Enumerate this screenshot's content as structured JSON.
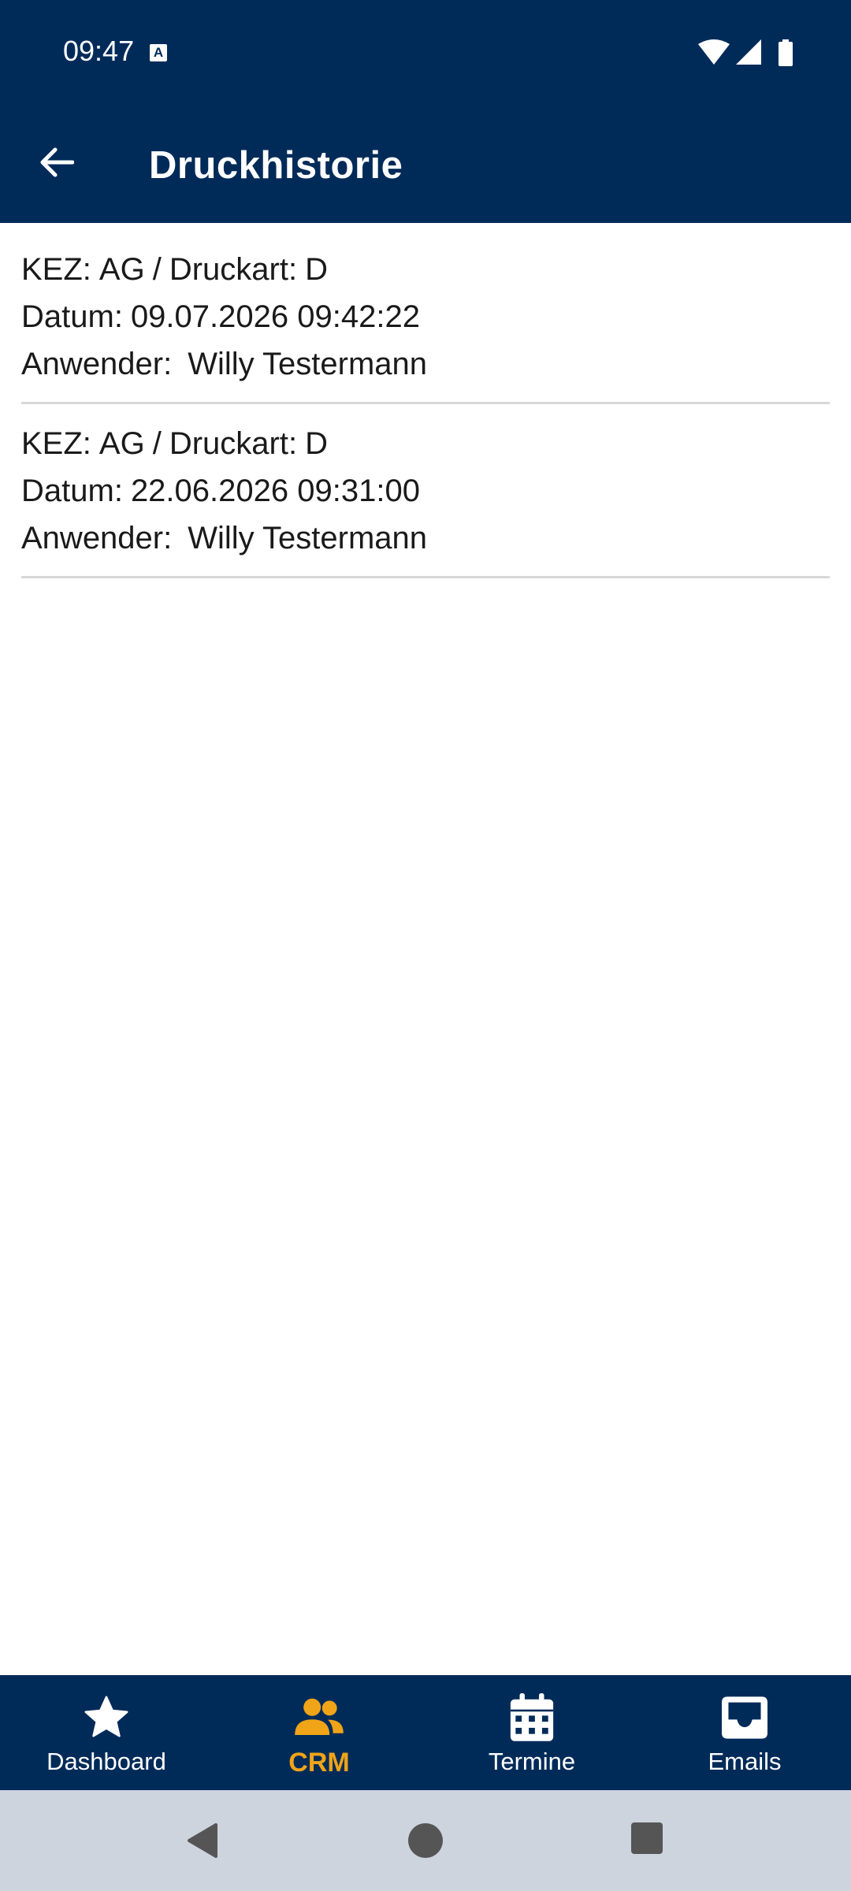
{
  "status_bar": {
    "time": "09:47",
    "notification_icon": "a-badge-icon",
    "icons": [
      "wifi-icon",
      "signal-icon",
      "battery-icon"
    ]
  },
  "app_bar": {
    "back_icon": "arrow-left-icon",
    "title": "Druckhistorie"
  },
  "history": [
    {
      "kez_label": "KEZ:",
      "kez_value": "AG",
      "separator": "/",
      "druckart_label": "Druckart:",
      "druckart_value": "D",
      "datum_label": "Datum:",
      "datum_value": "09.07.2026 09:42:22",
      "anwender_label": "Anwender:",
      "anwender_value": "Willy Testermann"
    },
    {
      "kez_label": "KEZ:",
      "kez_value": "AG",
      "separator": "/",
      "druckart_label": "Druckart:",
      "druckart_value": "D",
      "datum_label": "Datum:",
      "datum_value": "22.06.2026 09:31:00",
      "anwender_label": "Anwender:",
      "anwender_value": "Willy Testermann"
    }
  ],
  "bottom_nav": {
    "items": [
      {
        "label": "Dashboard",
        "icon": "star-icon",
        "active": false
      },
      {
        "label": "CRM",
        "icon": "people-icon",
        "active": true
      },
      {
        "label": "Termine",
        "icon": "calendar-icon",
        "active": false
      },
      {
        "label": "Emails",
        "icon": "inbox-icon",
        "active": false
      }
    ],
    "colors": {
      "background": "#002b59",
      "active": "#f0a417",
      "inactive": "#ffffff"
    }
  },
  "system_nav": {
    "icons": [
      "back-triangle-icon",
      "home-circle-icon",
      "recents-square-icon"
    ]
  }
}
